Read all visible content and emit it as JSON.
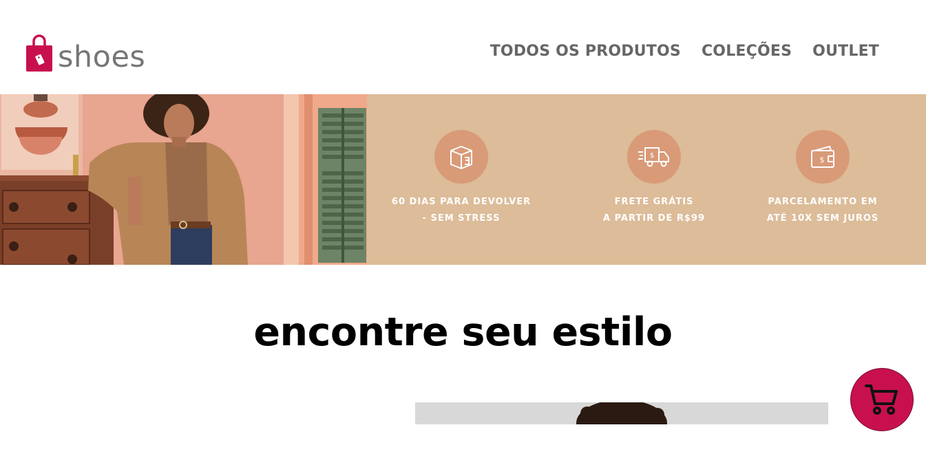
{
  "brand": {
    "name": "shoes",
    "color": "#c8104f"
  },
  "nav": {
    "items": [
      {
        "label": "TODOS OS PRODUTOS"
      },
      {
        "label": "COLEÇÕES"
      },
      {
        "label": "OUTLET"
      }
    ]
  },
  "banner": {
    "background": "#dcbc99",
    "perks": [
      {
        "icon": "return-box-icon",
        "line1": "60 DIAS PARA DEVOLVER",
        "line2": "-  SEM STRESS"
      },
      {
        "icon": "delivery-truck-icon",
        "line1": "FRETE GRÁTIS",
        "line2": "A PARTIR DE R$99"
      },
      {
        "icon": "wallet-card-icon",
        "line1": "PARCELAMENTO EM",
        "line2": "ATÉ 10X SEM JUROS"
      }
    ]
  },
  "section": {
    "title": "encontre seu estilo"
  },
  "cart": {
    "icon": "shopping-cart-icon",
    "color": "#c8104f"
  }
}
